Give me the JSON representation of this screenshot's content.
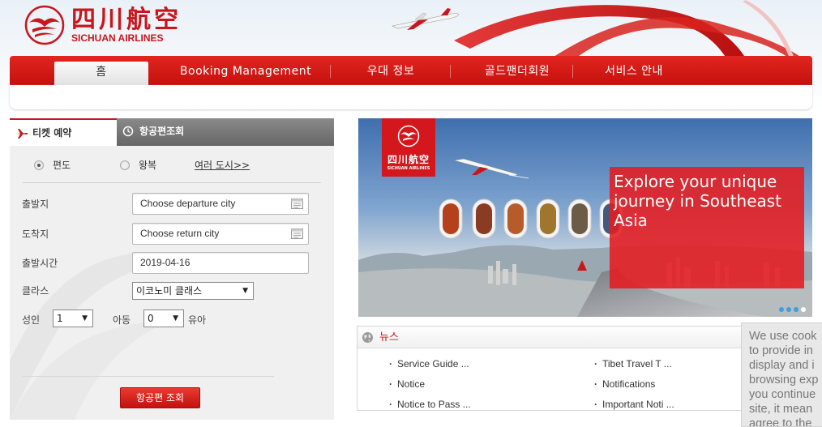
{
  "brand": {
    "name_cn": "四川航空",
    "name_en": "SICHUAN AIRLINES",
    "accent_color": "#c8161d"
  },
  "nav": {
    "items": [
      {
        "label": "홈"
      },
      {
        "label": "Booking Management"
      },
      {
        "label": "우대 정보"
      },
      {
        "label": "골드팬더회원"
      },
      {
        "label": "서비스 안내"
      }
    ]
  },
  "booking": {
    "tabs": [
      {
        "label": "티켓 예약",
        "icon": "plane-icon",
        "active": true
      },
      {
        "label": "항공편조회",
        "icon": "clock-icon",
        "active": false
      }
    ],
    "trip_types": [
      {
        "label": "편도",
        "checked": true
      },
      {
        "label": "왕복",
        "checked": false
      }
    ],
    "multi_city_link": "여러 도시>>",
    "departure": {
      "label": "출발지",
      "placeholder": "Choose departure city"
    },
    "arrival": {
      "label": "도착지",
      "placeholder": "Choose return city"
    },
    "date": {
      "label": "출발시간",
      "value": "2019-04-16"
    },
    "class": {
      "label": "클라스",
      "value": "이코노미 클래스"
    },
    "passengers": {
      "adult_label": "성인",
      "adult_value": "1",
      "child_label": "아동",
      "child_value": "0",
      "infant_label": "유아"
    },
    "search_button": "항공편 조회"
  },
  "banner": {
    "logo_cn": "四川航空",
    "logo_en": "SICHUAN AIRLINES",
    "promo_text": "Explore your unique journey in Southeast Asia",
    "slide_count": 4,
    "active_slide": 4
  },
  "news": {
    "title": "뉴스",
    "items": [
      {
        "label": "Service Guide ..."
      },
      {
        "label": "Tibet Travel T ..."
      },
      {
        "label": "Notice"
      },
      {
        "label": "Notifications"
      },
      {
        "label": "Notice to Pass ..."
      },
      {
        "label": "Important Noti ..."
      }
    ]
  },
  "cookie": {
    "lines": [
      "We use cook",
      "to provide in",
      "display and i",
      "browsing exp",
      "you continue",
      "site, it mean",
      "agree to the"
    ]
  }
}
